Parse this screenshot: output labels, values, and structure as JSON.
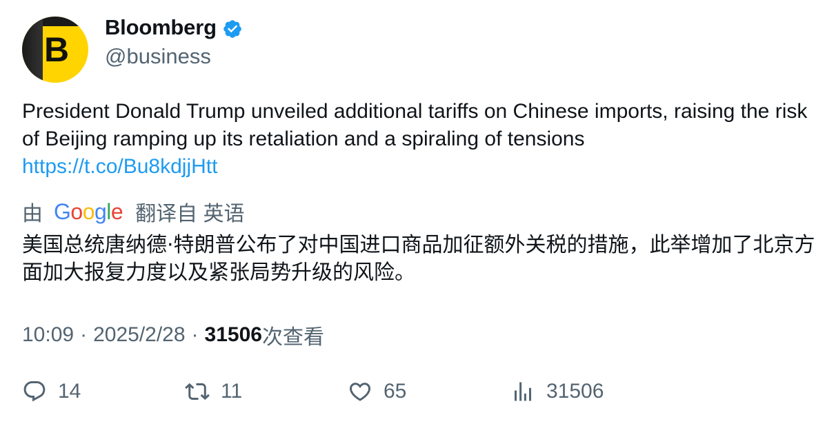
{
  "account": {
    "display_name": "Bloomberg",
    "handle": "@business",
    "avatar_letter": "B",
    "avatar_colors": {
      "yellow": "#ffd400",
      "dark": "#1a1a1a"
    },
    "verified": true,
    "verified_color": "#1d9bf0"
  },
  "tweet": {
    "text": "President Donald Trump unveiled additional tariffs on Chinese imports, raising the risk of Beijing ramping up its retaliation and a spiraling of tensions",
    "link": "https://t.co/Bu8kdjjHtt"
  },
  "translation": {
    "prefix": "由",
    "provider_logo": "Google",
    "suffix": "翻译自 英语",
    "text": "美国总统唐纳德·特朗普公布了对中国进口商品加征额外关税的措施，此举增加了北京方面加大报复力度以及紧张局势升级的风险。"
  },
  "meta": {
    "time": "10:09",
    "separator": "·",
    "date": "2025/2/28",
    "views_count": "31506",
    "views_label": "次查看"
  },
  "actions": {
    "replies": {
      "icon": "reply-icon",
      "count": "14"
    },
    "reposts": {
      "icon": "repost-icon",
      "count": "11"
    },
    "likes": {
      "icon": "like-icon",
      "count": "65"
    },
    "views": {
      "icon": "views-icon",
      "count": "31506"
    }
  },
  "colors": {
    "text_primary": "#0f1419",
    "text_secondary": "#536471",
    "link": "#1d9bf0",
    "google_blue": "#4285f4",
    "google_red": "#ea4335",
    "google_yellow": "#fbbc05",
    "google_green": "#34a853"
  }
}
